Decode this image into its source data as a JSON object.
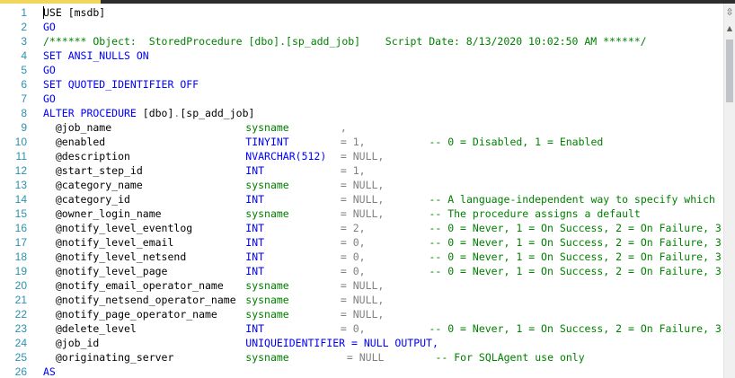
{
  "editor": {
    "lines": [
      {
        "n": "1",
        "parts": [
          {
            "t": "USE [msdb]",
            "c": "tx"
          }
        ]
      },
      {
        "n": "2",
        "parts": [
          {
            "t": "GO",
            "c": "kw"
          }
        ]
      },
      {
        "n": "3",
        "parts": [
          {
            "t": "/****** Object:  StoredProcedure [dbo].[sp_add_job]    Script Date: 8/13/2020 10:02:50 AM ******/",
            "c": "cm"
          }
        ]
      },
      {
        "n": "4",
        "parts": [
          {
            "t": "SET ANSI_NULLS ON",
            "c": "kw"
          }
        ]
      },
      {
        "n": "5",
        "parts": [
          {
            "t": "GO",
            "c": "kw"
          }
        ]
      },
      {
        "n": "6",
        "parts": [
          {
            "t": "SET QUOTED_IDENTIFIER OFF",
            "c": "kw"
          }
        ]
      },
      {
        "n": "7",
        "parts": [
          {
            "t": "GO",
            "c": "kw"
          }
        ]
      },
      {
        "n": "8",
        "parts": [
          {
            "t": "ALTER PROCEDURE ",
            "c": "kw"
          },
          {
            "t": "[dbo]",
            "c": "tx"
          },
          {
            "t": ".",
            "c": "gray"
          },
          {
            "t": "[sp_add_job]",
            "c": "tx"
          }
        ]
      },
      {
        "n": "9",
        "param": "  @job_name",
        "type": "sysname",
        "tc": "sys",
        "eq": ",",
        "eqc": "gray",
        "comment": ""
      },
      {
        "n": "10",
        "param": "  @enabled",
        "type": "TINYINT",
        "tc": "ty",
        "eq": "= 1,",
        "eqc": "gray",
        "comment": "-- 0 = Disabled, 1 = Enabled"
      },
      {
        "n": "11",
        "param": "  @description",
        "type": "NVARCHAR(512)",
        "tc": "ty",
        "eq": "= NULL,",
        "eqc": "gray",
        "comment": ""
      },
      {
        "n": "12",
        "param": "  @start_step_id",
        "type": "INT",
        "tc": "ty",
        "eq": "= 1,",
        "eqc": "gray",
        "comment": ""
      },
      {
        "n": "13",
        "param": "  @category_name",
        "type": "sysname",
        "tc": "sys",
        "eq": "= NULL,",
        "eqc": "gray",
        "comment": ""
      },
      {
        "n": "14",
        "param": "  @category_id",
        "type": "INT",
        "tc": "ty",
        "eq": "= NULL,",
        "eqc": "gray",
        "comment": "-- A language-independent way to specify which"
      },
      {
        "n": "15",
        "param": "  @owner_login_name",
        "type": "sysname",
        "tc": "sys",
        "eq": "= NULL,",
        "eqc": "gray",
        "comment": "-- The procedure assigns a default"
      },
      {
        "n": "16",
        "param": "  @notify_level_eventlog",
        "type": "INT",
        "tc": "ty",
        "eq": "= 2,",
        "eqc": "gray",
        "comment": "-- 0 = Never, 1 = On Success, 2 = On Failure, 3"
      },
      {
        "n": "17",
        "param": "  @notify_level_email",
        "type": "INT",
        "tc": "ty",
        "eq": "= 0,",
        "eqc": "gray",
        "comment": "-- 0 = Never, 1 = On Success, 2 = On Failure, 3"
      },
      {
        "n": "18",
        "param": "  @notify_level_netsend",
        "type": "INT",
        "tc": "ty",
        "eq": "= 0,",
        "eqc": "gray",
        "comment": "-- 0 = Never, 1 = On Success, 2 = On Failure, 3"
      },
      {
        "n": "19",
        "param": "  @notify_level_page",
        "type": "INT",
        "tc": "ty",
        "eq": "= 0,",
        "eqc": "gray",
        "comment": "-- 0 = Never, 1 = On Success, 2 = On Failure, 3"
      },
      {
        "n": "20",
        "param": "  @notify_email_operator_name",
        "type": "sysname",
        "tc": "sys",
        "eq": "= NULL,",
        "eqc": "gray",
        "comment": ""
      },
      {
        "n": "21",
        "param": "  @notify_netsend_operator_name",
        "type": "sysname",
        "tc": "sys",
        "eq": "= NULL,",
        "eqc": "gray",
        "comment": ""
      },
      {
        "n": "22",
        "param": "  @notify_page_operator_name",
        "type": "sysname",
        "tc": "sys",
        "eq": "= NULL,",
        "eqc": "gray",
        "comment": ""
      },
      {
        "n": "23",
        "param": "  @delete_level",
        "type": "INT",
        "tc": "ty",
        "eq": "= 0,",
        "eqc": "gray",
        "comment": "-- 0 = Never, 1 = On Success, 2 = On Failure, 3"
      },
      {
        "n": "24",
        "param": "  @job_id",
        "type": "UNIQUEIDENTIFIER = NULL OUTPUT,",
        "tc": "ty",
        "eq": "",
        "eqc": "gray",
        "comment": ""
      },
      {
        "n": "25",
        "param": "  @originating_server",
        "type": "sysname",
        "tc": "sys",
        "eq": "= NULL",
        "eqc": "gray",
        "comment": "-- For SQLAgent use only",
        "shift": true
      },
      {
        "n": "26",
        "parts": [
          {
            "t": "AS",
            "c": "kw"
          }
        ]
      }
    ]
  },
  "scrollbar": {
    "split_icon": "split-handle-icon",
    "up_icon": "chevron-up-icon",
    "split_glyph": "⇳",
    "up_glyph": "▲"
  },
  "colors": {
    "keyword": "#0000ff",
    "comment": "#008000",
    "line_number": "#2b91af",
    "operator": "#808080"
  }
}
